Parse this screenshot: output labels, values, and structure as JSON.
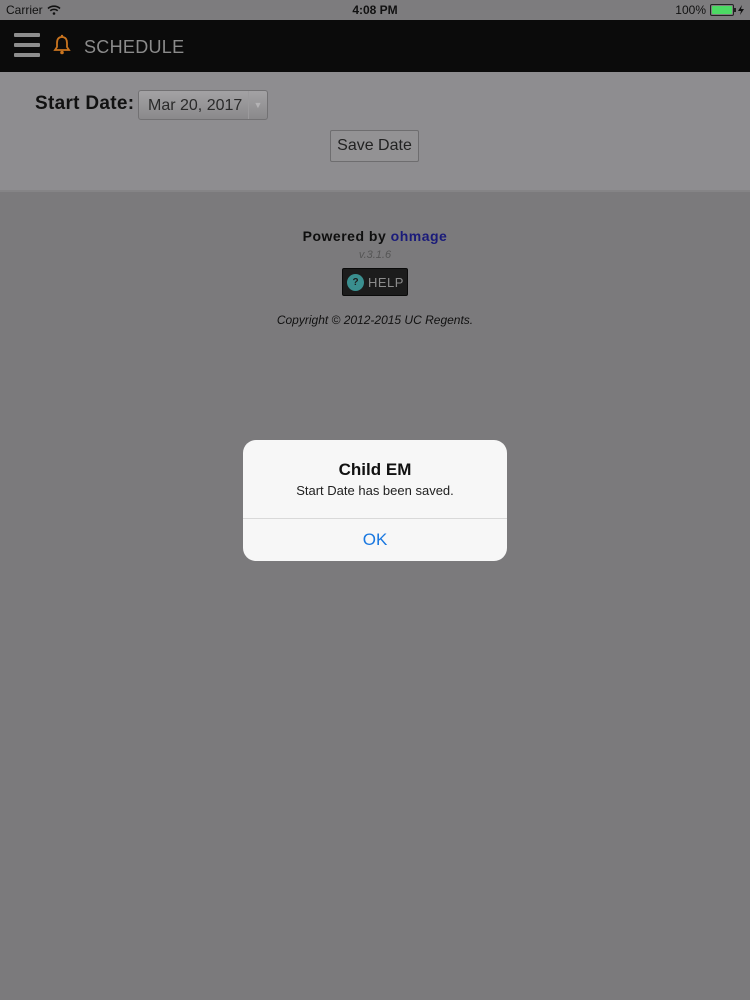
{
  "statusbar": {
    "carrier": "Carrier",
    "time": "4:08 PM",
    "battery": "100%",
    "battery_level": 1.0
  },
  "header": {
    "title": "SCHEDULE"
  },
  "form": {
    "start_label": "Start Date:",
    "date_value": "Mar 20, 2017",
    "save_label": "Save Date"
  },
  "footer": {
    "powered_prefix": "Powered by",
    "brand": "ohmage",
    "version": "v.3.1.6",
    "help_label": "HELP",
    "copyright": "Copyright © 2012-2015 UC Regents."
  },
  "alert": {
    "title": "Child EM",
    "message": "Start Date has been saved.",
    "ok_label": "OK"
  },
  "colors": {
    "header_bg": "#0b0b0b",
    "alert_button": "#1a78e0",
    "battery": "#4cd964",
    "brand": "#1a1b7a"
  }
}
